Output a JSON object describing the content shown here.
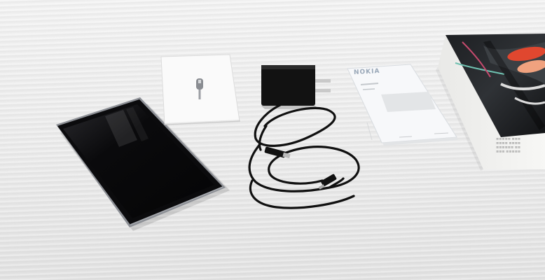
{
  "scene": {
    "description_items": [
      {
        "name": "smartphone",
        "state": "screen off"
      },
      {
        "name": "sim-eject-tool-card"
      },
      {
        "name": "usb-power-adapter"
      },
      {
        "name": "usb-cable"
      },
      {
        "name": "quick-start-manual"
      },
      {
        "name": "retail-box"
      }
    ]
  },
  "manual": {
    "brand": "NOKIA"
  },
  "box": {
    "print_lines": [
      "≡≡≡≡≡ ≡≡≡",
      "≡≡≡≡ ≡≡≡≡",
      "≡≡≡≡≡≡ ≡≡",
      "≡≡≡ ≡≡≡≡≡"
    ]
  },
  "colors": {
    "table": "#ebebeb",
    "phone_body": "#0b0b0d",
    "phone_frame": "#8c8f95",
    "adapter": "#121212",
    "cable": "#101010",
    "box_white": "#f4f4f2",
    "box_art_accent": "#e0472f"
  }
}
